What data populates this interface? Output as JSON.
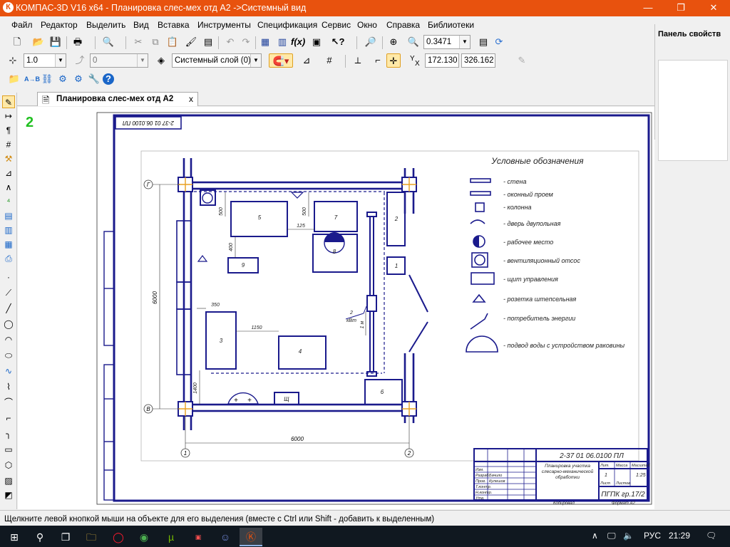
{
  "window": {
    "title": "КОМПАС-3D V16  x64 - Планировка слес-мех отд А2 ->Системный вид",
    "app_icon": "kompas-logo-icon",
    "minimize": "—",
    "maximize": "❐",
    "close": "✕"
  },
  "menu": [
    "Файл",
    "Редактор",
    "Выделить",
    "Вид",
    "Вставка",
    "Инструменты",
    "Спецификация",
    "Сервис",
    "Окно",
    "Справка",
    "Библиотеки"
  ],
  "toolbar1": {
    "zoom_value": "0.3471"
  },
  "toolbar2": {
    "step_value": "1.0",
    "angle_value": "0",
    "layer_value": "Системный слой (0)",
    "x_label": "X",
    "y_label": "Y",
    "x_coord": "172.130",
    "y_coord": "326.162"
  },
  "properties_panel": {
    "title": "Панель свойств"
  },
  "document_tab": {
    "label": "Планировка слес-мех отд А2",
    "close": "x"
  },
  "drawing": {
    "stamp_top": "2-37 01 06.0100 ПЛ",
    "view_number": "2",
    "legend_title": "Условные обозначения",
    "legend": [
      "- стена",
      "- оконный проем",
      "- колонна",
      "- дверь двупольная",
      "- рабочее место",
      "- вентиляционный отсос",
      "- щит управления",
      "- розетка штепсельная",
      "- потребитель энергии",
      "- подвод воды с устройством раковины"
    ],
    "dims": {
      "width": "6000",
      "height": "6000",
      "d350": "350",
      "d1150": "1150",
      "d125": "125",
      "d500a": "500",
      "d500b": "500",
      "d1400": "1400",
      "d400": "400",
      "d1m": "1 м",
      "d2kvt": "2",
      "kvt": "кВт"
    },
    "axes": {
      "g": "Г",
      "v": "В",
      "one": "1",
      "two": "2"
    },
    "equipment": {
      "e5": "5",
      "e7": "7",
      "e8": "8",
      "e9": "9",
      "e2": "2",
      "e1": "1",
      "e3": "3",
      "e4": "4",
      "e6": "6",
      "shield": "Щ"
    },
    "title_block": {
      "code": "2-37 01 06.0100 ПЛ",
      "name": "Планировка участка слесарно-механической обработки",
      "group": "ПГПК гр.17/2",
      "scale": "1:25",
      "sheet": "1",
      "col_lit": "Лит.",
      "col_mass": "Масса",
      "col_scale": "Масштаб",
      "col_sheet": "Лист",
      "col_sheets": "Листов",
      "rows": [
        "Изм.",
        "Разраб.",
        "Пров.",
        "Т.контр.",
        "Н.контр.",
        "Утв."
      ],
      "dev_name": "Бачило",
      "check_name": "Кулешов",
      "copied": "Копировал",
      "format": "Формат А2"
    }
  },
  "status": {
    "message": "Щелкните левой кнопкой мыши на объекте для его выделения (вместе с Ctrl или Shift - добавить к выделенным)"
  },
  "taskbar": {
    "lang": "РУС",
    "time": "21:29",
    "items": [
      "start-icon",
      "search-icon",
      "task-view-icon",
      "file-explorer-icon",
      "opera-icon",
      "chrome-icon",
      "utorrent-icon",
      "media-app-icon",
      "discord-icon",
      "kompas-taskbar-icon"
    ]
  }
}
